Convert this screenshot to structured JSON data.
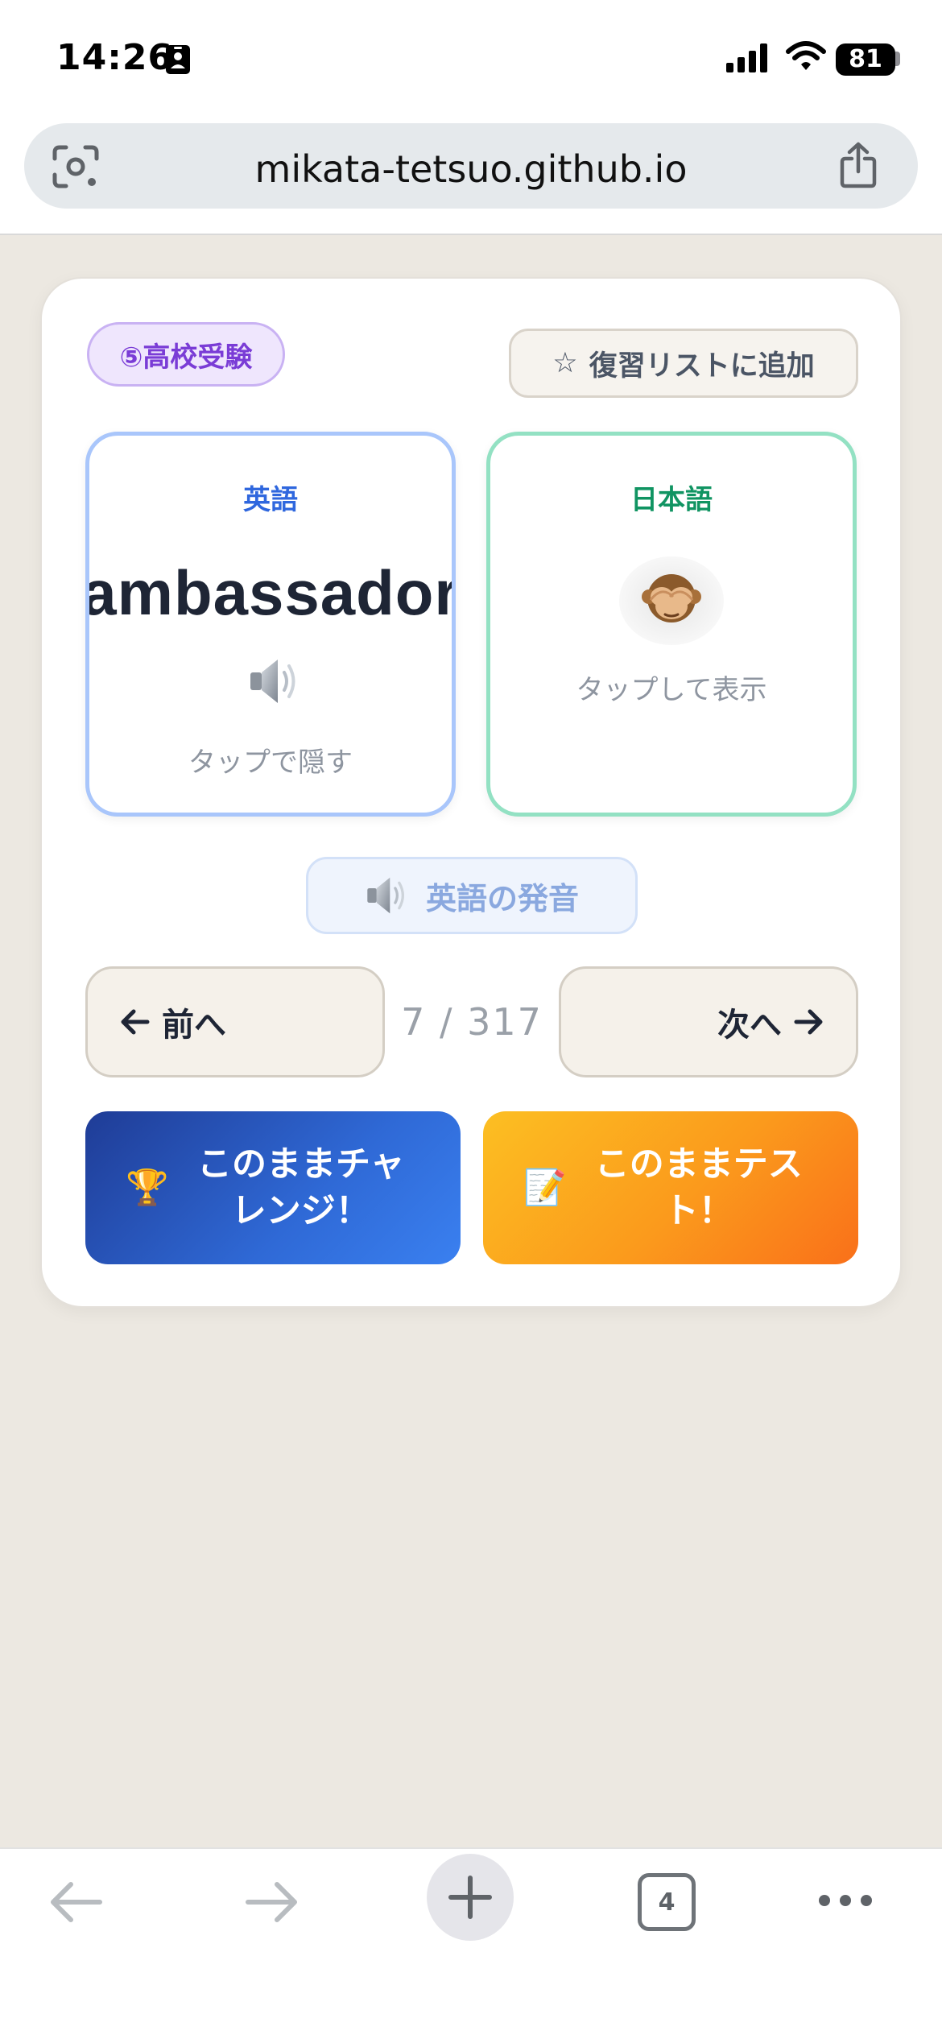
{
  "status_bar": {
    "time": "14:26",
    "battery": "81",
    "icons": [
      "person-badge-icon",
      "signal-icon",
      "wifi-icon",
      "battery-icon"
    ]
  },
  "browser": {
    "url": "mikata-tetsuo.github.io",
    "icons": [
      "lens-icon",
      "share-icon"
    ]
  },
  "card": {
    "category": "⑤高校受験",
    "review_button": "復習リストに追加",
    "review_icon": "☆",
    "english_card": {
      "label": "英語",
      "word": "ambassador",
      "hint": "タップで隠す"
    },
    "japanese_card": {
      "label": "日本語",
      "emoji": "🙈",
      "hint": "タップして表示"
    },
    "pronounce_button": "英語の発音",
    "prev_button": "前へ",
    "next_button": "次へ",
    "counter": "7 / 317",
    "challenge_button": "このままチャレンジ！",
    "challenge_emoji": "🏆",
    "test_button": "このままテスト！",
    "test_emoji": "📝"
  },
  "toolbar": {
    "tab_count": "4",
    "icons": [
      "back-arrow-icon",
      "forward-arrow-icon",
      "plus-icon",
      "tabs-icon",
      "more-icon"
    ]
  },
  "colors": {
    "page_background": "#ECE8E1",
    "english_border": "#A9C6FB",
    "japanese_border": "#93E1C3",
    "category_purple": "#7A3CD6",
    "challenge_blue": "#2F69D6",
    "test_orange": "#FB9A1C"
  }
}
